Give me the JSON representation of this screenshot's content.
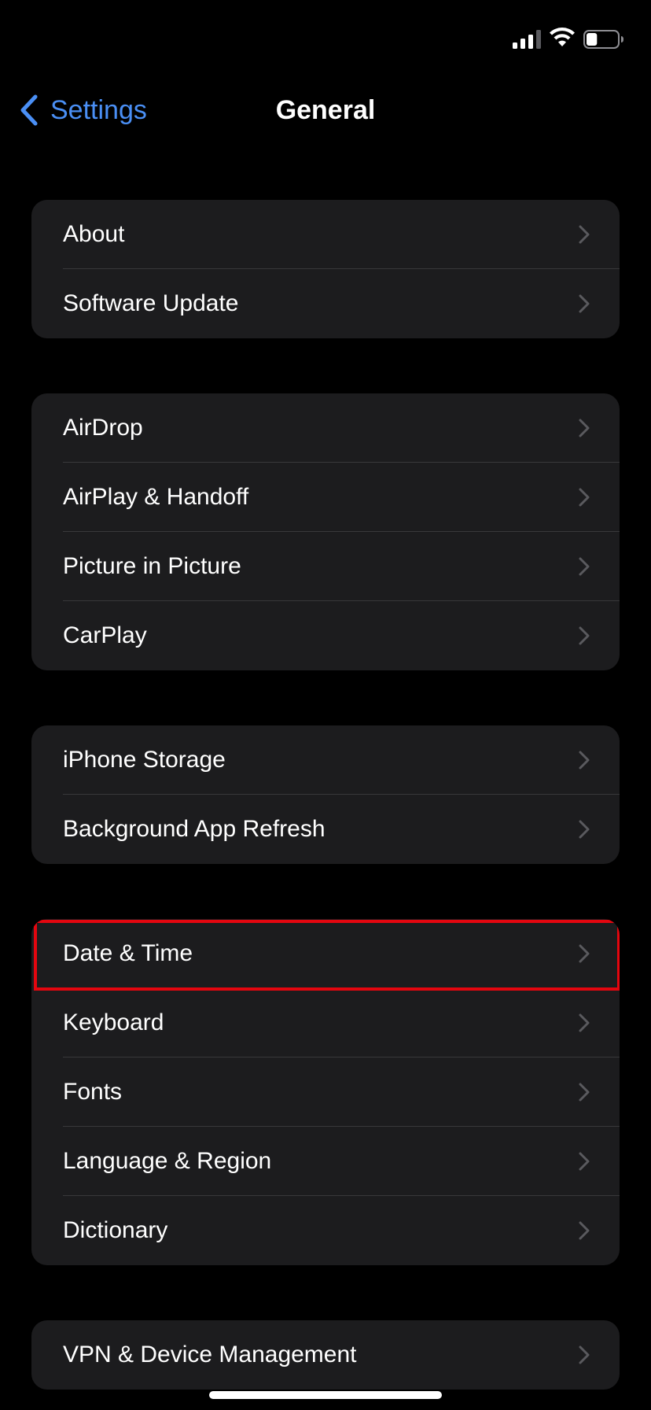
{
  "status_bar": {
    "signal_icon": "cellular-signal-icon",
    "wifi_icon": "wifi-icon",
    "battery_icon": "battery-icon",
    "battery_level": 0.35
  },
  "nav": {
    "back_label": "Settings",
    "title": "General"
  },
  "colors": {
    "background": "#000000",
    "group_background": "#1c1c1e",
    "accent": "#4a8ff5",
    "divider": "#38383a",
    "chevron": "#5a5a5e",
    "highlight": "#e3060f"
  },
  "groups": [
    {
      "items": [
        {
          "label": "About"
        },
        {
          "label": "Software Update"
        }
      ]
    },
    {
      "items": [
        {
          "label": "AirDrop"
        },
        {
          "label": "AirPlay & Handoff"
        },
        {
          "label": "Picture in Picture"
        },
        {
          "label": "CarPlay"
        }
      ]
    },
    {
      "items": [
        {
          "label": "iPhone Storage"
        },
        {
          "label": "Background App Refresh"
        }
      ]
    },
    {
      "items": [
        {
          "label": "Date & Time",
          "highlighted": true
        },
        {
          "label": "Keyboard"
        },
        {
          "label": "Fonts"
        },
        {
          "label": "Language & Region"
        },
        {
          "label": "Dictionary"
        }
      ]
    },
    {
      "items": [
        {
          "label": "VPN & Device Management"
        }
      ]
    }
  ]
}
